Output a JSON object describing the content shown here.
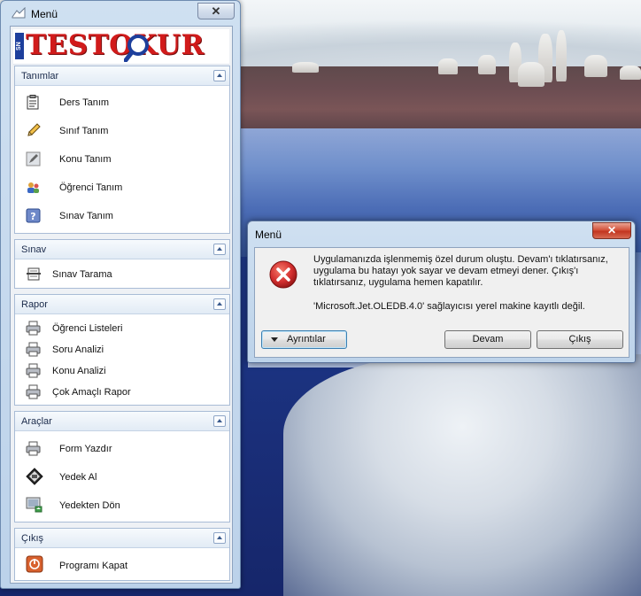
{
  "menu_window": {
    "title": "Menü",
    "close_label": "✕",
    "logo": {
      "text": "TESTOKUR",
      "side_text": "SN"
    },
    "panels": [
      {
        "title": "Tanımlar",
        "items": [
          {
            "label": "Ders Tanım",
            "icon": "clipboard-icon"
          },
          {
            "label": "Sınıf Tanım",
            "icon": "pencil-icon"
          },
          {
            "label": "Konu Tanım",
            "icon": "notebook-icon"
          },
          {
            "label": "Öğrenci Tanım",
            "icon": "users-icon"
          },
          {
            "label": "Sınav Tanım",
            "icon": "help-icon"
          }
        ]
      },
      {
        "title": "Sınav",
        "items": [
          {
            "label": "Sınav Tarama",
            "icon": "scanner-icon"
          }
        ]
      },
      {
        "title": "Rapor",
        "items": [
          {
            "label": "Öğrenci Listeleri",
            "icon": "printer-icon"
          },
          {
            "label": "Soru Analizi",
            "icon": "printer-icon"
          },
          {
            "label": "Konu Analizi",
            "icon": "printer-icon"
          },
          {
            "label": "Çok Amaçlı Rapor",
            "icon": "printer-icon"
          }
        ]
      },
      {
        "title": "Araçlar",
        "items": [
          {
            "label": "Form Yazdır",
            "icon": "printer-icon"
          },
          {
            "label": "Yedek Al",
            "icon": "backup-icon"
          },
          {
            "label": "Yedekten Dön",
            "icon": "restore-icon"
          }
        ]
      },
      {
        "title": "Çıkış",
        "items": [
          {
            "label": "Programı Kapat",
            "icon": "power-icon"
          }
        ]
      }
    ]
  },
  "dialog": {
    "title": "Menü",
    "close_label": "✕",
    "message": "Uygulamanızda işlenmemiş özel durum oluştu. Devam'ı tıklatırsanız, uygulama bu hatayı yok sayar ve devam etmeyi dener. Çıkış'ı tıklatırsanız, uygulama hemen kapatılır.",
    "detail": "'Microsoft.Jet.OLEDB.4.0' sağlayıcısı yerel makine kayıtlı değil.",
    "buttons": {
      "details": "Ayrıntılar",
      "continue": "Devam",
      "quit": "Çıkış"
    },
    "icon": "error-icon",
    "colors": {
      "error": "#d32f2f",
      "close_button": "#c23520"
    }
  }
}
